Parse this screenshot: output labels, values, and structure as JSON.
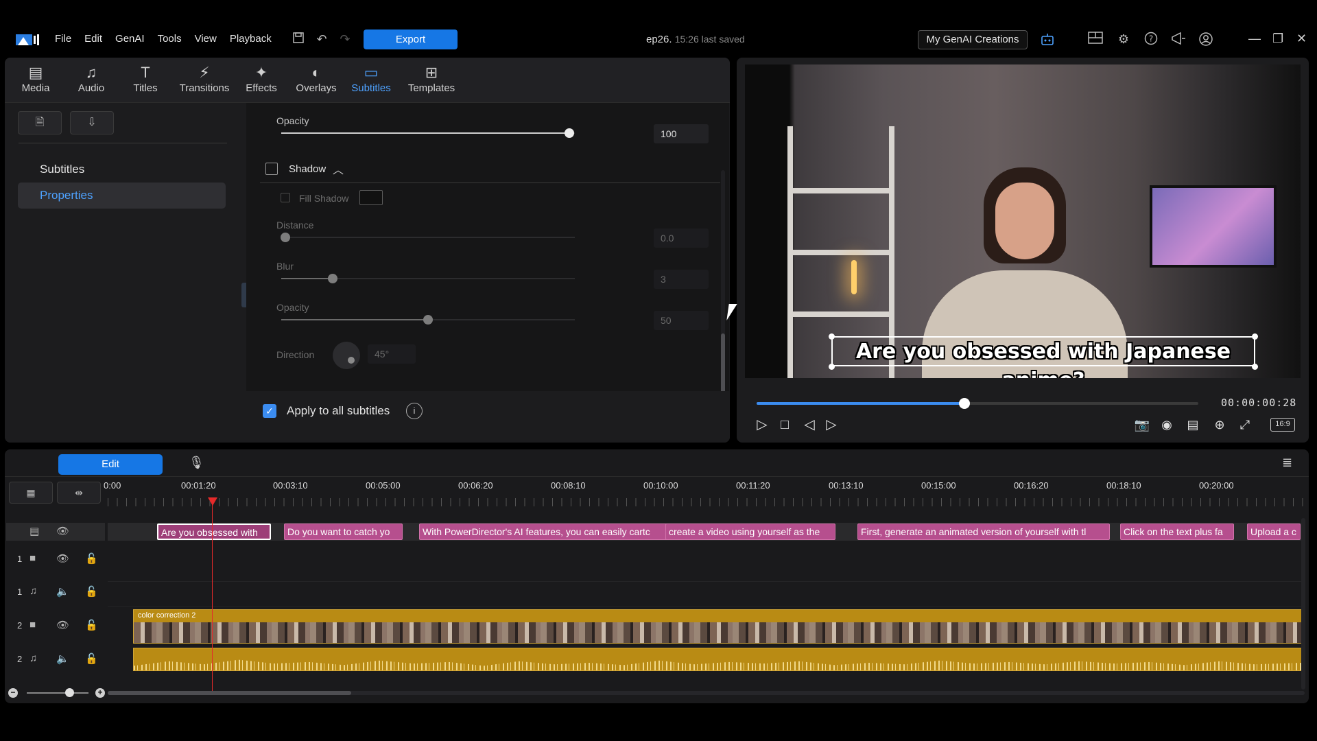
{
  "menu": {
    "items": [
      "File",
      "Edit",
      "GenAI",
      "Tools",
      "View",
      "Playback"
    ],
    "export_label": "Export",
    "project_name": "ep26.",
    "saved_status": "15:26 last saved",
    "genai_button": "My GenAI Creations"
  },
  "rooms": [
    {
      "label": "Media",
      "icon": "media-icon"
    },
    {
      "label": "Audio",
      "icon": "music-note-icon"
    },
    {
      "label": "Titles",
      "icon": "text-icon"
    },
    {
      "label": "Transitions",
      "icon": "transition-icon"
    },
    {
      "label": "Effects",
      "icon": "effects-icon"
    },
    {
      "label": "Overlays",
      "icon": "overlays-icon"
    },
    {
      "label": "Subtitles",
      "icon": "subtitles-icon",
      "active": true
    },
    {
      "label": "Templates",
      "icon": "templates-icon"
    }
  ],
  "side": {
    "title": "Subtitles",
    "selected": "Properties"
  },
  "props": {
    "opacity_label": "Opacity",
    "opacity_value": "100",
    "shadow_label": "Shadow",
    "fill_shadow_label": "Fill Shadow",
    "distance_label": "Distance",
    "distance_value": "0.0",
    "blur_label": "Blur",
    "blur_value": "3",
    "shadow_opacity_label": "Opacity",
    "shadow_opacity_value": "50",
    "direction_label": "Direction",
    "direction_value": "45°",
    "apply_all_label": "Apply to all subtitles"
  },
  "preview": {
    "caption": "Are you obsessed with Japanese anime?",
    "timecode": "00:00:00:28",
    "aspect": "16:9",
    "progress": 0.47
  },
  "timeline": {
    "edit_label": "Edit",
    "ruler": [
      "0:00",
      "00:01:20",
      "00:03:10",
      "00:05:00",
      "00:06:20",
      "00:08:10",
      "00:10:00",
      "00:11:20",
      "00:13:10",
      "00:15:00",
      "00:16:20",
      "00:18:10",
      "00:20:00"
    ],
    "subtitle_clips": [
      "Are you obsessed with",
      "Do you want to catch yo",
      "With PowerDirector's AI features, you can easily cartc",
      "create a video using yourself as the",
      "First, generate an animated version of yourself with tl",
      "Click on the text plus fa",
      "Upload a c"
    ],
    "tracks": [
      {
        "num": "1",
        "type": "video"
      },
      {
        "num": "1",
        "type": "audio"
      },
      {
        "num": "2",
        "type": "video"
      },
      {
        "num": "2",
        "type": "audio"
      }
    ],
    "video_clip_label": "color correction 2"
  },
  "colors": {
    "accent": "#1677e5",
    "subtitle_clip": "#b64f8e",
    "media_clip": "#b98b14",
    "playhead": "#e52a2a"
  }
}
